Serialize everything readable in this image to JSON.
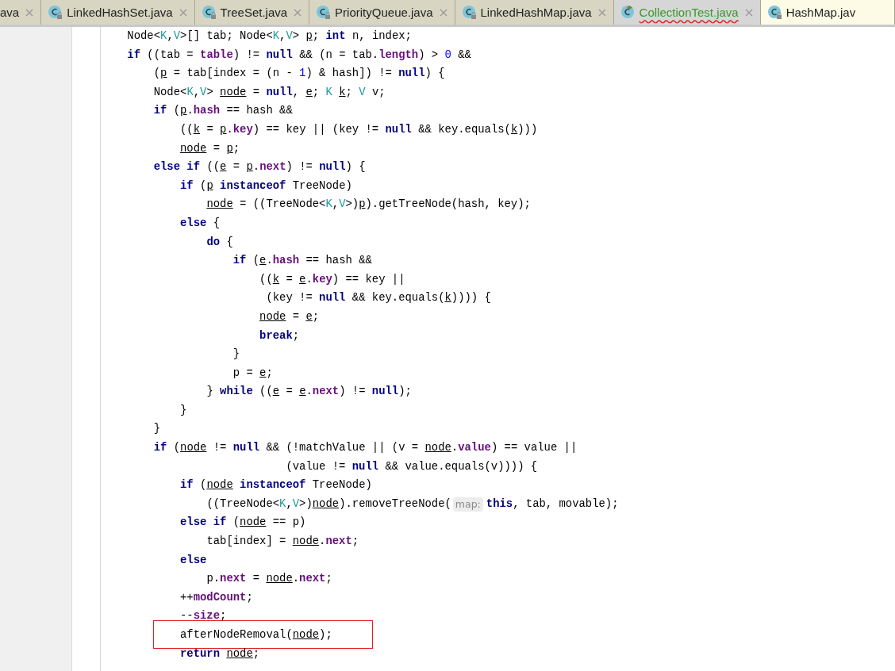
{
  "tabs": [
    {
      "label": "ava",
      "has_icon": false,
      "closable": true,
      "added": false,
      "has_errors": false,
      "selected": false
    },
    {
      "label": "LinkedHashSet.java",
      "has_icon": true,
      "locked": true,
      "closable": true,
      "added": false,
      "has_errors": false,
      "selected": false
    },
    {
      "label": "TreeSet.java",
      "has_icon": true,
      "locked": true,
      "closable": true,
      "added": false,
      "has_errors": false,
      "selected": false
    },
    {
      "label": "PriorityQueue.java",
      "has_icon": true,
      "locked": true,
      "closable": true,
      "added": false,
      "has_errors": false,
      "selected": false
    },
    {
      "label": "LinkedHashMap.java",
      "has_icon": true,
      "locked": true,
      "closable": true,
      "added": false,
      "has_errors": false,
      "selected": false
    },
    {
      "label": "CollectionTest.java",
      "has_icon": true,
      "locked": false,
      "closable": true,
      "added": true,
      "has_errors": true,
      "selected": false
    },
    {
      "label": "HashMap.jav",
      "has_icon": true,
      "locked": true,
      "closable": false,
      "added": false,
      "has_errors": false,
      "selected": true
    }
  ],
  "lines": [
    {
      "boxed": false,
      "tokens": [
        {
          "t": "    Node<",
          "kind": "plain"
        },
        {
          "t": "K",
          "kind": "type"
        },
        {
          "t": ",",
          "kind": "plain"
        },
        {
          "t": "V",
          "kind": "type"
        },
        {
          "t": ">[] tab; Node<",
          "kind": "plain"
        },
        {
          "t": "K",
          "kind": "type"
        },
        {
          "t": ",",
          "kind": "plain"
        },
        {
          "t": "V",
          "kind": "type"
        },
        {
          "t": "> ",
          "kind": "plain"
        },
        {
          "t": "p",
          "kind": "local"
        },
        {
          "t": "; ",
          "kind": "plain"
        },
        {
          "t": "int",
          "kind": "keyword"
        },
        {
          "t": " n, index;",
          "kind": "plain"
        }
      ]
    },
    {
      "boxed": false,
      "tokens": [
        {
          "t": "    if",
          "kind": "keyword"
        },
        {
          "t": " ((tab = ",
          "kind": "plain"
        },
        {
          "t": "table",
          "kind": "field"
        },
        {
          "t": ") != ",
          "kind": "plain"
        },
        {
          "t": "null",
          "kind": "keyword"
        },
        {
          "t": " && (n = tab.",
          "kind": "plain"
        },
        {
          "t": "length",
          "kind": "field"
        },
        {
          "t": ") > ",
          "kind": "plain"
        },
        {
          "t": "0",
          "kind": "number"
        },
        {
          "t": " &&",
          "kind": "plain"
        }
      ]
    },
    {
      "boxed": false,
      "tokens": [
        {
          "t": "        (",
          "kind": "plain"
        },
        {
          "t": "p",
          "kind": "local"
        },
        {
          "t": " = tab[index = (n - ",
          "kind": "plain"
        },
        {
          "t": "1",
          "kind": "number"
        },
        {
          "t": ") & hash]) != ",
          "kind": "plain"
        },
        {
          "t": "null",
          "kind": "keyword"
        },
        {
          "t": ") {",
          "kind": "plain"
        }
      ]
    },
    {
      "boxed": false,
      "tokens": [
        {
          "t": "        Node<",
          "kind": "plain"
        },
        {
          "t": "K",
          "kind": "type"
        },
        {
          "t": ",",
          "kind": "plain"
        },
        {
          "t": "V",
          "kind": "type"
        },
        {
          "t": "> ",
          "kind": "plain"
        },
        {
          "t": "node",
          "kind": "local"
        },
        {
          "t": " = ",
          "kind": "plain"
        },
        {
          "t": "null",
          "kind": "keyword"
        },
        {
          "t": ", ",
          "kind": "plain"
        },
        {
          "t": "e",
          "kind": "local"
        },
        {
          "t": "; ",
          "kind": "plain"
        },
        {
          "t": "K",
          "kind": "type"
        },
        {
          "t": " k",
          "kind": "local"
        },
        {
          "t": "; ",
          "kind": "plain"
        },
        {
          "t": "V",
          "kind": "type"
        },
        {
          "t": " v;",
          "kind": "plain"
        }
      ]
    },
    {
      "boxed": false,
      "tokens": [
        {
          "t": "        if",
          "kind": "keyword"
        },
        {
          "t": " (",
          "kind": "plain"
        },
        {
          "t": "p",
          "kind": "local"
        },
        {
          "t": ".",
          "kind": "plain"
        },
        {
          "t": "hash",
          "kind": "field"
        },
        {
          "t": " == hash &&",
          "kind": "plain"
        }
      ]
    },
    {
      "boxed": false,
      "tokens": [
        {
          "t": "            ((",
          "kind": "plain"
        },
        {
          "t": "k",
          "kind": "local"
        },
        {
          "t": " = ",
          "kind": "plain"
        },
        {
          "t": "p",
          "kind": "local"
        },
        {
          "t": ".",
          "kind": "plain"
        },
        {
          "t": "key",
          "kind": "field"
        },
        {
          "t": ") == key || (key != ",
          "kind": "plain"
        },
        {
          "t": "null",
          "kind": "keyword"
        },
        {
          "t": " && key.equals(",
          "kind": "plain"
        },
        {
          "t": "k",
          "kind": "local"
        },
        {
          "t": ")))",
          "kind": "plain"
        }
      ]
    },
    {
      "boxed": false,
      "tokens": [
        {
          "t": "            node",
          "kind": "local"
        },
        {
          "t": " = ",
          "kind": "plain"
        },
        {
          "t": "p",
          "kind": "local"
        },
        {
          "t": ";",
          "kind": "plain"
        }
      ]
    },
    {
      "boxed": false,
      "tokens": [
        {
          "t": "        else if",
          "kind": "keyword"
        },
        {
          "t": " ((",
          "kind": "plain"
        },
        {
          "t": "e",
          "kind": "local"
        },
        {
          "t": " = ",
          "kind": "plain"
        },
        {
          "t": "p",
          "kind": "local"
        },
        {
          "t": ".",
          "kind": "plain"
        },
        {
          "t": "next",
          "kind": "field"
        },
        {
          "t": ") != ",
          "kind": "plain"
        },
        {
          "t": "null",
          "kind": "keyword"
        },
        {
          "t": ") {",
          "kind": "plain"
        }
      ]
    },
    {
      "boxed": false,
      "tokens": [
        {
          "t": "            if",
          "kind": "keyword"
        },
        {
          "t": " (",
          "kind": "plain"
        },
        {
          "t": "p",
          "kind": "local"
        },
        {
          "t": " instanceof",
          "kind": "keyword"
        },
        {
          "t": " TreeNode)",
          "kind": "plain"
        }
      ]
    },
    {
      "boxed": false,
      "tokens": [
        {
          "t": "                node",
          "kind": "local"
        },
        {
          "t": " = ((TreeNode<",
          "kind": "plain"
        },
        {
          "t": "K",
          "kind": "type"
        },
        {
          "t": ",",
          "kind": "plain"
        },
        {
          "t": "V",
          "kind": "type"
        },
        {
          "t": ">)",
          "kind": "plain"
        },
        {
          "t": "p",
          "kind": "local"
        },
        {
          "t": ").getTreeNode(hash, key);",
          "kind": "plain"
        }
      ]
    },
    {
      "boxed": false,
      "tokens": [
        {
          "t": "            else",
          "kind": "keyword"
        },
        {
          "t": " {",
          "kind": "plain"
        }
      ]
    },
    {
      "boxed": false,
      "tokens": [
        {
          "t": "                do",
          "kind": "keyword"
        },
        {
          "t": " {",
          "kind": "plain"
        }
      ]
    },
    {
      "boxed": false,
      "tokens": [
        {
          "t": "                    if",
          "kind": "keyword"
        },
        {
          "t": " (",
          "kind": "plain"
        },
        {
          "t": "e",
          "kind": "local"
        },
        {
          "t": ".",
          "kind": "plain"
        },
        {
          "t": "hash",
          "kind": "field"
        },
        {
          "t": " == hash &&",
          "kind": "plain"
        }
      ]
    },
    {
      "boxed": false,
      "tokens": [
        {
          "t": "                        ((",
          "kind": "plain"
        },
        {
          "t": "k",
          "kind": "local"
        },
        {
          "t": " = ",
          "kind": "plain"
        },
        {
          "t": "e",
          "kind": "local"
        },
        {
          "t": ".",
          "kind": "plain"
        },
        {
          "t": "key",
          "kind": "field"
        },
        {
          "t": ") == key ||",
          "kind": "plain"
        }
      ]
    },
    {
      "boxed": false,
      "tokens": [
        {
          "t": "                         (key != ",
          "kind": "plain"
        },
        {
          "t": "null",
          "kind": "keyword"
        },
        {
          "t": " && key.equals(",
          "kind": "plain"
        },
        {
          "t": "k",
          "kind": "local"
        },
        {
          "t": ")))) {",
          "kind": "plain"
        }
      ]
    },
    {
      "boxed": false,
      "tokens": [
        {
          "t": "                        node",
          "kind": "local"
        },
        {
          "t": " = ",
          "kind": "plain"
        },
        {
          "t": "e",
          "kind": "local"
        },
        {
          "t": ";",
          "kind": "plain"
        }
      ]
    },
    {
      "boxed": false,
      "tokens": [
        {
          "t": "                        break",
          "kind": "keyword"
        },
        {
          "t": ";",
          "kind": "plain"
        }
      ]
    },
    {
      "boxed": false,
      "tokens": [
        {
          "t": "                    }",
          "kind": "plain"
        }
      ]
    },
    {
      "boxed": false,
      "tokens": [
        {
          "t": "                    p = ",
          "kind": "plain"
        },
        {
          "t": "e",
          "kind": "local"
        },
        {
          "t": ";",
          "kind": "plain"
        }
      ]
    },
    {
      "boxed": false,
      "tokens": [
        {
          "t": "                }",
          "kind": "plain"
        },
        {
          "t": " while",
          "kind": "keyword"
        },
        {
          "t": " ((",
          "kind": "plain"
        },
        {
          "t": "e",
          "kind": "local"
        },
        {
          "t": " = ",
          "kind": "plain"
        },
        {
          "t": "e",
          "kind": "local"
        },
        {
          "t": ".",
          "kind": "plain"
        },
        {
          "t": "next",
          "kind": "field"
        },
        {
          "t": ") != ",
          "kind": "plain"
        },
        {
          "t": "null",
          "kind": "keyword"
        },
        {
          "t": ");",
          "kind": "plain"
        }
      ]
    },
    {
      "boxed": false,
      "tokens": [
        {
          "t": "            }",
          "kind": "plain"
        }
      ]
    },
    {
      "boxed": false,
      "tokens": [
        {
          "t": "        }",
          "kind": "plain"
        }
      ]
    },
    {
      "boxed": false,
      "tokens": [
        {
          "t": "        if",
          "kind": "keyword"
        },
        {
          "t": " (",
          "kind": "plain"
        },
        {
          "t": "node",
          "kind": "local"
        },
        {
          "t": " != ",
          "kind": "plain"
        },
        {
          "t": "null",
          "kind": "keyword"
        },
        {
          "t": " && (!matchValue || (v = ",
          "kind": "plain"
        },
        {
          "t": "node",
          "kind": "local"
        },
        {
          "t": ".",
          "kind": "plain"
        },
        {
          "t": "value",
          "kind": "field"
        },
        {
          "t": ") == value ||",
          "kind": "plain"
        }
      ]
    },
    {
      "boxed": false,
      "tokens": [
        {
          "t": "                            (value != ",
          "kind": "plain"
        },
        {
          "t": "null",
          "kind": "keyword"
        },
        {
          "t": " && value.equals(v)))) {",
          "kind": "plain"
        }
      ]
    },
    {
      "boxed": false,
      "tokens": [
        {
          "t": "            if",
          "kind": "keyword"
        },
        {
          "t": " (",
          "kind": "plain"
        },
        {
          "t": "node",
          "kind": "local"
        },
        {
          "t": " instanceof",
          "kind": "keyword"
        },
        {
          "t": " TreeNode)",
          "kind": "plain"
        }
      ]
    },
    {
      "boxed": false,
      "tokens": [
        {
          "t": "                ((TreeNode<",
          "kind": "plain"
        },
        {
          "t": "K",
          "kind": "type"
        },
        {
          "t": ",",
          "kind": "plain"
        },
        {
          "t": "V",
          "kind": "type"
        },
        {
          "t": ">)",
          "kind": "plain"
        },
        {
          "t": "node",
          "kind": "local"
        },
        {
          "t": ").removeTreeNode(",
          "kind": "plain"
        },
        {
          "t": "map:",
          "kind": "hint"
        },
        {
          "t": "this",
          "kind": "keyword"
        },
        {
          "t": ", tab, movable);",
          "kind": "plain"
        }
      ]
    },
    {
      "boxed": false,
      "tokens": [
        {
          "t": "            else if",
          "kind": "keyword"
        },
        {
          "t": " (",
          "kind": "plain"
        },
        {
          "t": "node",
          "kind": "local"
        },
        {
          "t": " == p)",
          "kind": "plain"
        }
      ]
    },
    {
      "boxed": false,
      "tokens": [
        {
          "t": "                tab[index] = ",
          "kind": "plain"
        },
        {
          "t": "node",
          "kind": "local"
        },
        {
          "t": ".",
          "kind": "plain"
        },
        {
          "t": "next",
          "kind": "field"
        },
        {
          "t": ";",
          "kind": "plain"
        }
      ]
    },
    {
      "boxed": false,
      "tokens": [
        {
          "t": "            else",
          "kind": "keyword"
        }
      ]
    },
    {
      "boxed": false,
      "tokens": [
        {
          "t": "                p.",
          "kind": "plain"
        },
        {
          "t": "next",
          "kind": "field"
        },
        {
          "t": " = ",
          "kind": "plain"
        },
        {
          "t": "node",
          "kind": "local"
        },
        {
          "t": ".",
          "kind": "plain"
        },
        {
          "t": "next",
          "kind": "field"
        },
        {
          "t": ";",
          "kind": "plain"
        }
      ]
    },
    {
      "boxed": false,
      "tokens": [
        {
          "t": "            ++",
          "kind": "plain"
        },
        {
          "t": "modCount",
          "kind": "field"
        },
        {
          "t": ";",
          "kind": "plain"
        }
      ]
    },
    {
      "boxed": false,
      "tokens": [
        {
          "t": "            --",
          "kind": "plain"
        },
        {
          "t": "size",
          "kind": "field"
        },
        {
          "t": ";",
          "kind": "plain"
        }
      ]
    },
    {
      "boxed": true,
      "tokens": [
        {
          "t": "            afterNodeRemoval(",
          "kind": "plain"
        },
        {
          "t": "node",
          "kind": "local"
        },
        {
          "t": ");",
          "kind": "plain"
        }
      ]
    },
    {
      "boxed": false,
      "tokens": [
        {
          "t": "            return",
          "kind": "keyword"
        },
        {
          "t": " node",
          "kind": "local"
        },
        {
          "t": ";",
          "kind": "plain"
        }
      ]
    }
  ]
}
